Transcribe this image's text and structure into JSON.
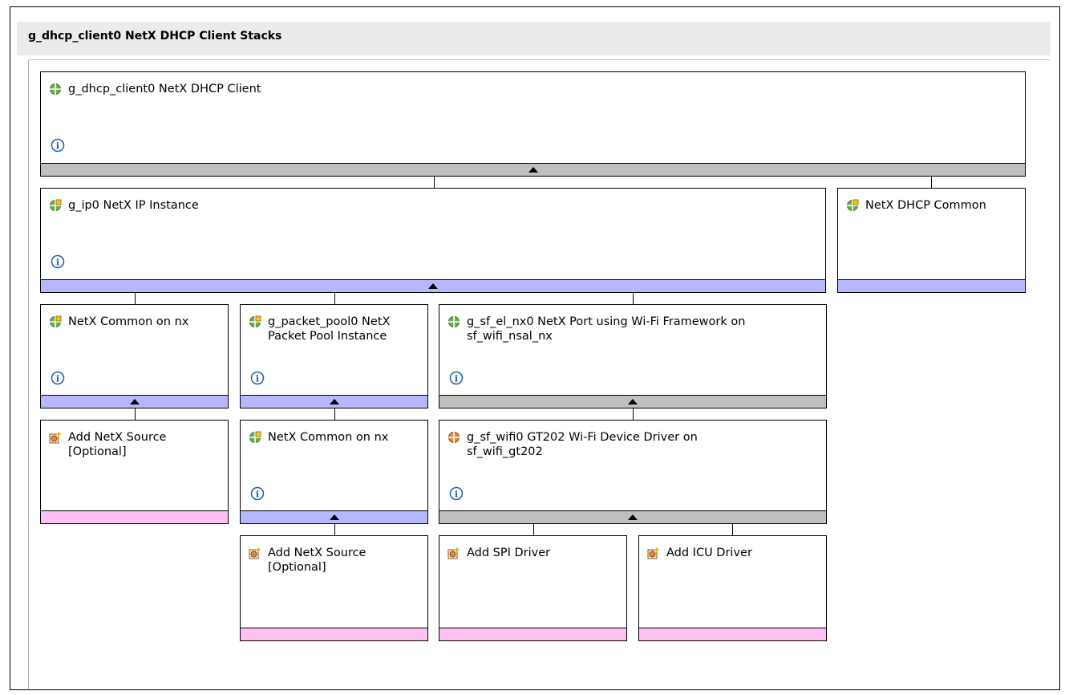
{
  "header": {
    "title": "g_dhcp_client0 NetX DHCP Client Stacks"
  },
  "modules": {
    "dhcp_client": {
      "label": "g_dhcp_client0 NetX DHCP Client"
    },
    "ip_instance": {
      "label": "g_ip0 NetX IP Instance"
    },
    "dhcp_common": {
      "label": "NetX DHCP Common"
    },
    "netx_common_1": {
      "label": "NetX Common on nx"
    },
    "packet_pool": {
      "label": "g_packet_pool0 NetX Packet Pool Instance"
    },
    "sf_el_nx": {
      "label": "g_sf_el_nx0 NetX Port using Wi-Fi Framework on sf_wifi_nsal_nx"
    },
    "add_netx_source_1": {
      "label": "Add NetX Source [Optional]"
    },
    "netx_common_2": {
      "label": "NetX Common on nx"
    },
    "sf_wifi": {
      "label": "g_sf_wifi0 GT202 Wi-Fi Device Driver on sf_wifi_gt202"
    },
    "add_netx_source_2": {
      "label": "Add NetX Source [Optional]"
    },
    "add_spi": {
      "label": "Add SPI Driver"
    },
    "add_icu": {
      "label": "Add ICU Driver"
    }
  },
  "colors": {
    "bar_gray": "#bfbfbf",
    "bar_blue": "#b7b7ff",
    "bar_pink": "#ffc0f2",
    "header_bg": "#ebebeb"
  },
  "icons": {
    "module": "module-icon",
    "add": "add-module-icon",
    "info": "info-icon",
    "expand": "collapse-arrow-icon"
  }
}
